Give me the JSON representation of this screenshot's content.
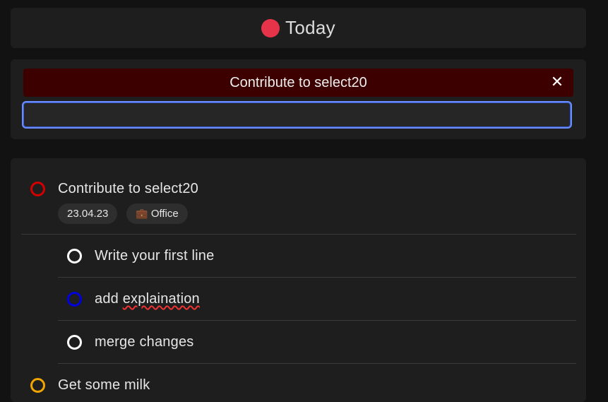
{
  "header": {
    "title": "Today",
    "dot_color": "#e5344a"
  },
  "editor": {
    "banner_text": "Contribute to select20",
    "close_glyph": "✕",
    "input_value": "",
    "input_placeholder": ""
  },
  "tasks": [
    {
      "label": "Contribute to select20",
      "status_color": "#d40000",
      "chips": {
        "date": "23.04.23",
        "category_icon": "💼",
        "category": "Office"
      },
      "subtasks": [
        {
          "label": "Write your first line",
          "status_color": "#ffffff"
        },
        {
          "label_prefix": "add ",
          "label_spell": "explaination",
          "status_color": "#0000e0"
        },
        {
          "label": "merge changes",
          "status_color": "#ffffff"
        }
      ]
    },
    {
      "label": "Get some milk",
      "status_color": "#f0a500"
    }
  ]
}
